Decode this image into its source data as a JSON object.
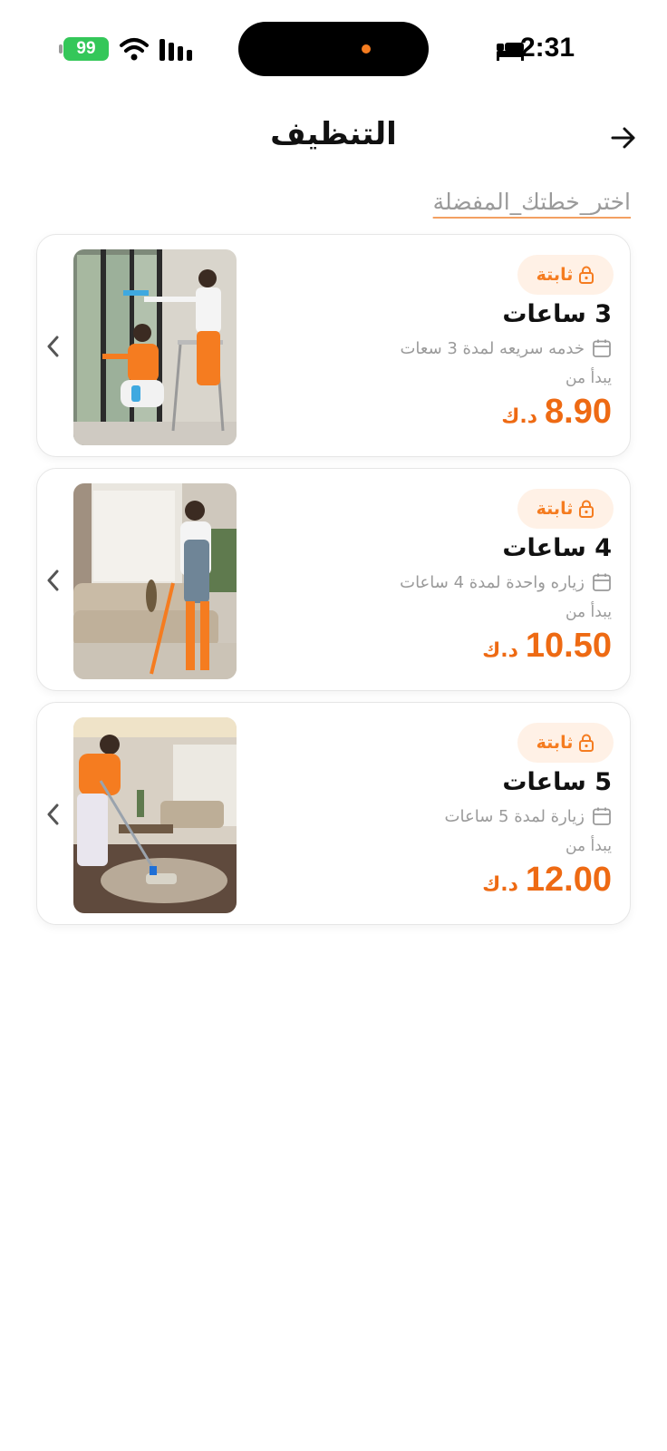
{
  "status_bar": {
    "time": "2:31",
    "battery": "99"
  },
  "header": {
    "title": "التنظيف",
    "subtitle": "اختر_خطتك_المفضلة"
  },
  "plans": [
    {
      "badge": "ثابتة",
      "title": "3 ساعات",
      "description": "خدمه سريعه لمدة 3 سعات",
      "from_label": "يبدأ من",
      "price": "8.90",
      "currency": "د.ك"
    },
    {
      "badge": "ثابتة",
      "title": "4 ساعات",
      "description": "زياره واحدة لمدة 4 ساعات",
      "from_label": "يبدأ من",
      "price": "10.50",
      "currency": "د.ك"
    },
    {
      "badge": "ثابتة",
      "title": "5 ساعات",
      "description": "زيارة لمدة 5 ساعات",
      "from_label": "يبدأ من",
      "price": "12.00",
      "currency": "د.ك"
    }
  ],
  "colors": {
    "accent": "#f57c20",
    "price": "#ee6a13",
    "badge_bg": "#fff1e6",
    "muted": "#9a9a9a"
  }
}
